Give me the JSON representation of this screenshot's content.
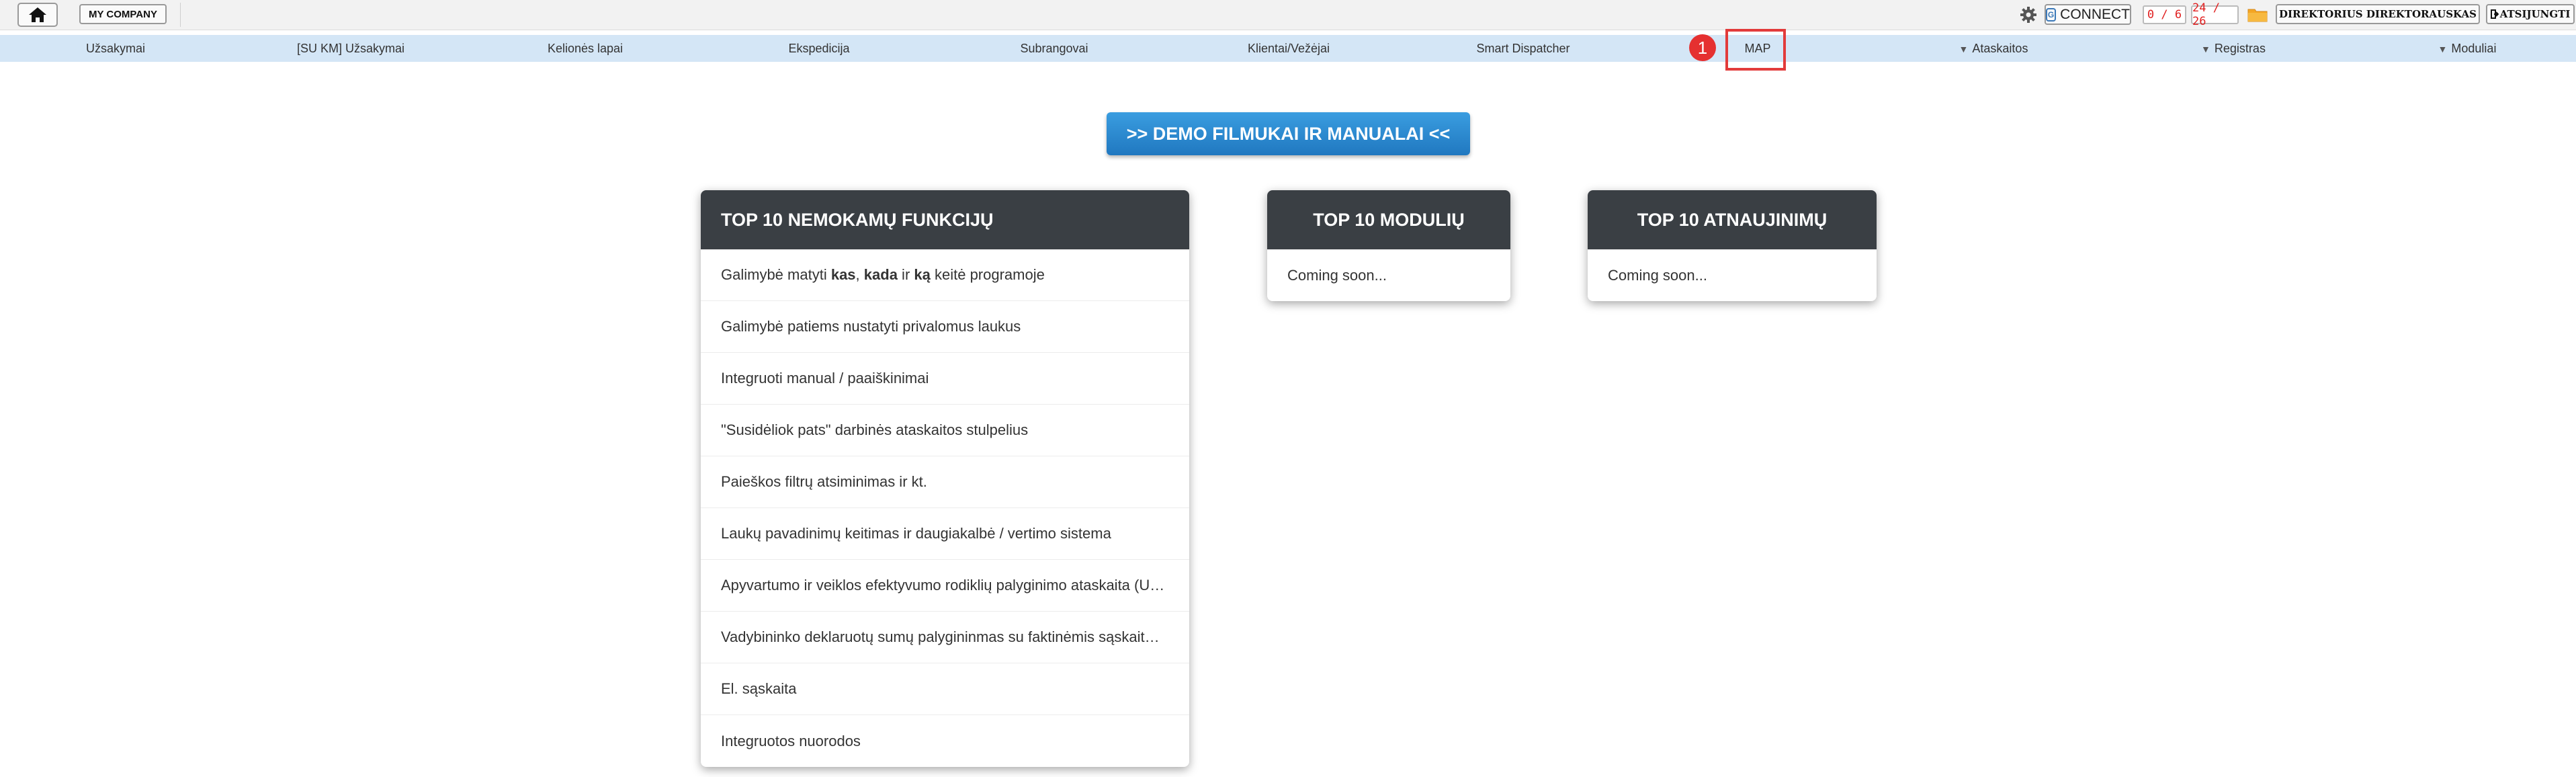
{
  "topbar": {
    "home_icon": "home-icon",
    "company_label": "MY COMPANY",
    "settings_icon": "gear-icon",
    "connect_label": "CONNECT",
    "counter1": "0 / 6",
    "counter2": "24 / 26",
    "folder_icon": "folder-icon",
    "user_label": "DIREKTORIUS DIREKTORAUSKAS",
    "logout_label": "ATSIJUNGTI"
  },
  "nav": {
    "items": [
      {
        "label": "Užsakymai"
      },
      {
        "label": "[SU KM] Užsakymai"
      },
      {
        "label": "Kelionės lapai"
      },
      {
        "label": "Ekspedicija"
      },
      {
        "label": "Subrangovai"
      },
      {
        "label": "Klientai/Vežėjai"
      },
      {
        "label": "Smart Dispatcher"
      },
      {
        "label": "MAP"
      },
      {
        "label": "Ataskaitos",
        "dropdown": "▼"
      },
      {
        "label": "Registras",
        "dropdown": "▼"
      },
      {
        "label": "Moduliai",
        "dropdown": "▼"
      }
    ],
    "highlight_badge": "1"
  },
  "demo_button": ">> DEMO FILMUKAI IR MANUALAI <<",
  "cards": {
    "features": {
      "title": "TOP 10 NEMOKAMŲ FUNKCIJŲ",
      "first_item": {
        "p1": "Galimybė matyti ",
        "b1": "kas",
        "p2": ", ",
        "b2": "kada",
        "p3": " ir ",
        "b3": "ką",
        "p4": " keitė programoje"
      },
      "items": [
        "Galimybė patiems nustatyti privalomus laukus",
        "Integruoti manual / paaiškinimai",
        "\"Susidėliok pats\" darbinės ataskaitos stulpelius",
        "Paieškos filtrų atsiminimas ir kt.",
        "Laukų pavadinimų keitimas ir daugiakalbė / vertimo sistema",
        "Apyvartumo ir veiklos efektyvumo rodiklių palyginimo ataskaita (U…",
        "Vadybininko deklaruotų sumų palygininmas su faktinėmis sąskait…",
        "El. sąskaita",
        "Integruotos nuorodos"
      ]
    },
    "modules": {
      "title": "TOP 10 MODULIŲ",
      "text": "Coming soon..."
    },
    "updates": {
      "title": "TOP 10 ATNAUJINIMŲ",
      "text": "Coming soon..."
    }
  }
}
